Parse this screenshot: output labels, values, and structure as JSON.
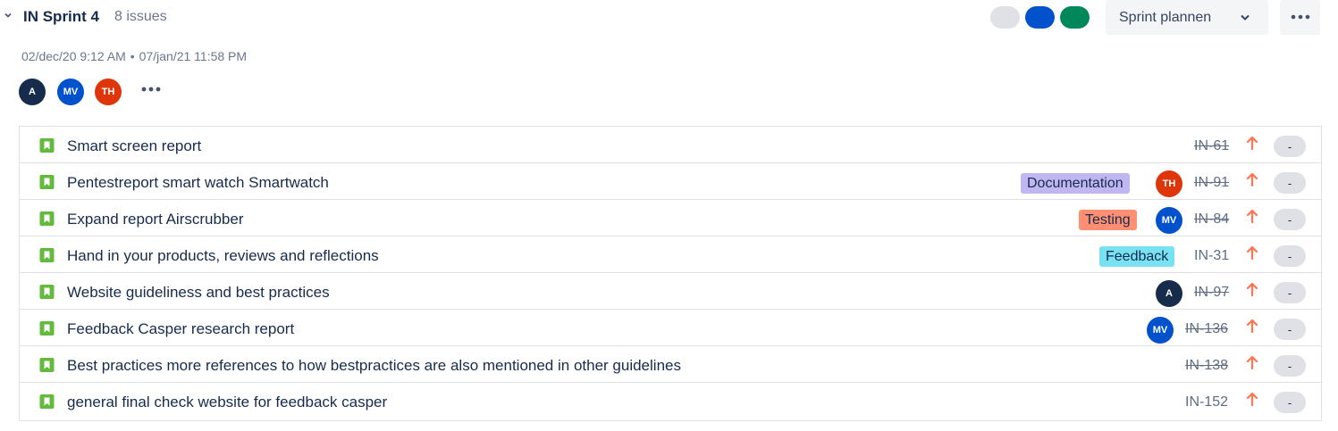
{
  "sprint": {
    "title": "IN Sprint 4",
    "issue_count": "8 issues",
    "start": "02/dec/20 9:12 AM",
    "separator": "•",
    "end": "07/jan/21 11:58 PM",
    "plan_button_label": "Sprint plannen",
    "status_colors": [
      "#dfe1e6",
      "#0052cc",
      "#00875a"
    ]
  },
  "team": [
    {
      "initials": "A",
      "color": "#172b4d"
    },
    {
      "initials": "MV",
      "color": "#0052cc"
    },
    {
      "initials": "TH",
      "color": "#de350b"
    }
  ],
  "label_colors": {
    "Documentation": "#c0b6f2",
    "Testing": "#ff8f73",
    "Feedback": "#79e2f2"
  },
  "issues": [
    {
      "summary": "Smart screen report",
      "label": "",
      "assignee": "",
      "key": "IN-61",
      "done": true,
      "priority": "high",
      "estimate": "-"
    },
    {
      "summary": "Pentestreport smart watch Smartwatch",
      "label": "Documentation",
      "assignee": "TH",
      "key": "IN-91",
      "done": true,
      "priority": "high",
      "estimate": "-"
    },
    {
      "summary": "Expand report Airscrubber",
      "label": "Testing",
      "assignee": "MV",
      "key": "IN-84",
      "done": true,
      "priority": "high",
      "estimate": "-"
    },
    {
      "summary": "Hand in your products, reviews and reflections",
      "label": "Feedback",
      "assignee": "",
      "key": "IN-31",
      "done": false,
      "priority": "high",
      "estimate": "-"
    },
    {
      "summary": "Website guideliness and best practices",
      "label": "",
      "assignee": "A",
      "key": "IN-97",
      "done": true,
      "priority": "high",
      "estimate": "-"
    },
    {
      "summary": "Feedback Casper research report",
      "label": "",
      "assignee": "MV",
      "key": "IN-136",
      "done": true,
      "priority": "high",
      "estimate": "-"
    },
    {
      "summary": "Best practices more references to how bestpractices are also mentioned in other guidelines",
      "label": "",
      "assignee": "",
      "key": "IN-138",
      "done": true,
      "priority": "high",
      "estimate": "-"
    },
    {
      "summary": "general final check website for feedback casper",
      "label": "",
      "assignee": "",
      "key": "IN-152",
      "done": false,
      "priority": "high",
      "estimate": "-"
    }
  ]
}
